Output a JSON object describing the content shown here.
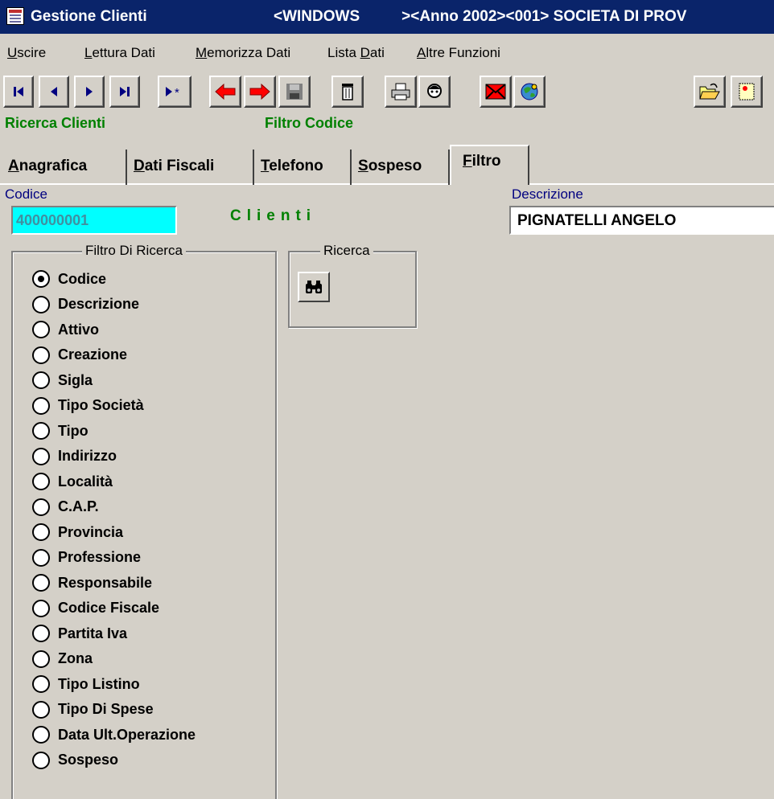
{
  "titlebar": {
    "title": "Gestione Clienti",
    "context_1": "<WINDOWS",
    "context_2": "><Anno 2002><001> SOCIETA DI PROV"
  },
  "menu": [
    {
      "underlined": "U",
      "rest": "scire"
    },
    {
      "underlined": "L",
      "rest": "ettura Dati"
    },
    {
      "underlined": "M",
      "rest": "emorizza Dati"
    },
    {
      "prefix": "Lista ",
      "underlined": "D",
      "rest": "ati"
    },
    {
      "underlined": "A",
      "rest": "ltre Funzioni"
    }
  ],
  "toolbar": [
    {
      "name": "first-record-button",
      "icon": "first-record-icon"
    },
    {
      "name": "previous-record-button",
      "icon": "previous-record-icon"
    },
    {
      "name": "next-record-button",
      "icon": "next-record-icon"
    },
    {
      "name": "last-record-button",
      "icon": "last-record-icon"
    },
    {
      "name": "new-record-button",
      "icon": "new-record-icon"
    },
    {
      "name": "undo-button",
      "icon": "left-arrow-icon"
    },
    {
      "name": "redo-button",
      "icon": "right-arrow-icon"
    },
    {
      "name": "save-button",
      "icon": "floppy-icon"
    },
    {
      "name": "delete-button",
      "icon": "trash-icon"
    },
    {
      "name": "print-button",
      "icon": "printer-icon"
    },
    {
      "name": "contact-button",
      "icon": "head-icon"
    },
    {
      "name": "email-button",
      "icon": "mail-icon"
    },
    {
      "name": "web-button",
      "icon": "globe-icon"
    },
    {
      "name": "open-folder-button",
      "icon": "folder-open-icon"
    },
    {
      "name": "note-button",
      "icon": "note-icon"
    }
  ],
  "status": {
    "left": "Ricerca Clienti",
    "right": "Filtro Codice"
  },
  "tabs": [
    {
      "underlined": "A",
      "rest": "nagrafica",
      "active": false
    },
    {
      "underlined": "D",
      "rest": "ati Fiscali",
      "active": false
    },
    {
      "underlined": "T",
      "rest": "elefono",
      "active": false
    },
    {
      "underlined": "S",
      "rest": "ospeso",
      "active": false
    },
    {
      "underlined": "F",
      "rest": "iltro",
      "active": true
    }
  ],
  "fields": {
    "codice_label": "Codice",
    "codice_value": "400000001",
    "clienti_label": "Clienti",
    "descrizione_label": "Descrizione",
    "descrizione_value": "PIGNATELLI ANGELO"
  },
  "filtro": {
    "legend": "Filtro Di Ricerca",
    "selected": "Codice",
    "options": [
      "Codice",
      "Descrizione",
      "Attivo",
      "Creazione",
      "Sigla",
      "Tipo Società",
      "Tipo",
      "Indirizzo",
      "Località",
      "C.A.P.",
      "Provincia",
      "Professione",
      "Responsabile",
      "Codice Fiscale",
      "Partita Iva",
      "Zona",
      "Tipo Listino",
      "Tipo Di Spese",
      "Data Ult.Operazione",
      "Sospeso"
    ]
  },
  "ricerca": {
    "legend": "Ricerca",
    "button_icon": "binoculars-icon"
  },
  "colors": {
    "title_bg": "#0a246a",
    "status_green": "#008000",
    "codice_bg": "#00ffff",
    "label_blue": "#000080"
  }
}
